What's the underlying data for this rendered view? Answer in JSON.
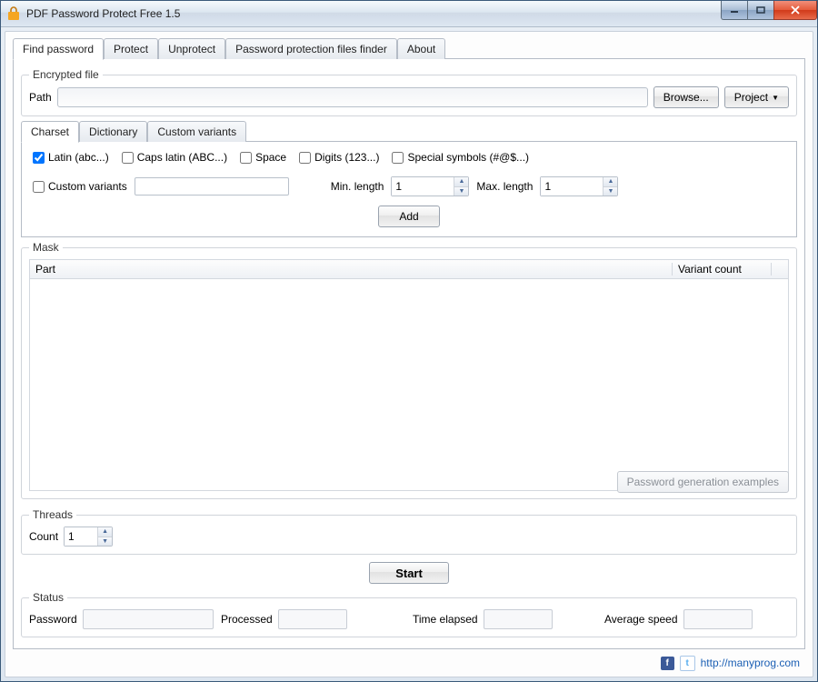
{
  "window": {
    "title": "PDF Password Protect Free 1.5"
  },
  "tabs": {
    "find": "Find password",
    "protect": "Protect",
    "unprotect": "Unprotect",
    "finder": "Password protection files finder",
    "about": "About"
  },
  "encrypted": {
    "legend": "Encrypted file",
    "path_label": "Path",
    "path_value": "",
    "browse": "Browse...",
    "project": "Project"
  },
  "charset": {
    "tab_charset": "Charset",
    "tab_dictionary": "Dictionary",
    "tab_custom": "Custom variants",
    "latin": "Latin (abc...)",
    "caps": "Caps latin (ABC...)",
    "space": "Space",
    "digits": "Digits (123...)",
    "special": "Special symbols (#@$...)",
    "custom_variants": "Custom variants",
    "custom_value": "",
    "min_label": "Min. length",
    "min_value": "1",
    "max_label": "Max. length",
    "max_value": "1",
    "add": "Add"
  },
  "mask": {
    "legend": "Mask",
    "col_part": "Part",
    "col_variant": "Variant count",
    "examples_btn": "Password generation examples"
  },
  "threads": {
    "legend": "Threads",
    "count_label": "Count",
    "count_value": "1"
  },
  "start": "Start",
  "status": {
    "legend": "Status",
    "password": "Password",
    "processed": "Processed",
    "elapsed": "Time elapsed",
    "speed": "Average speed"
  },
  "footer": {
    "url": "http://manyprog.com"
  }
}
